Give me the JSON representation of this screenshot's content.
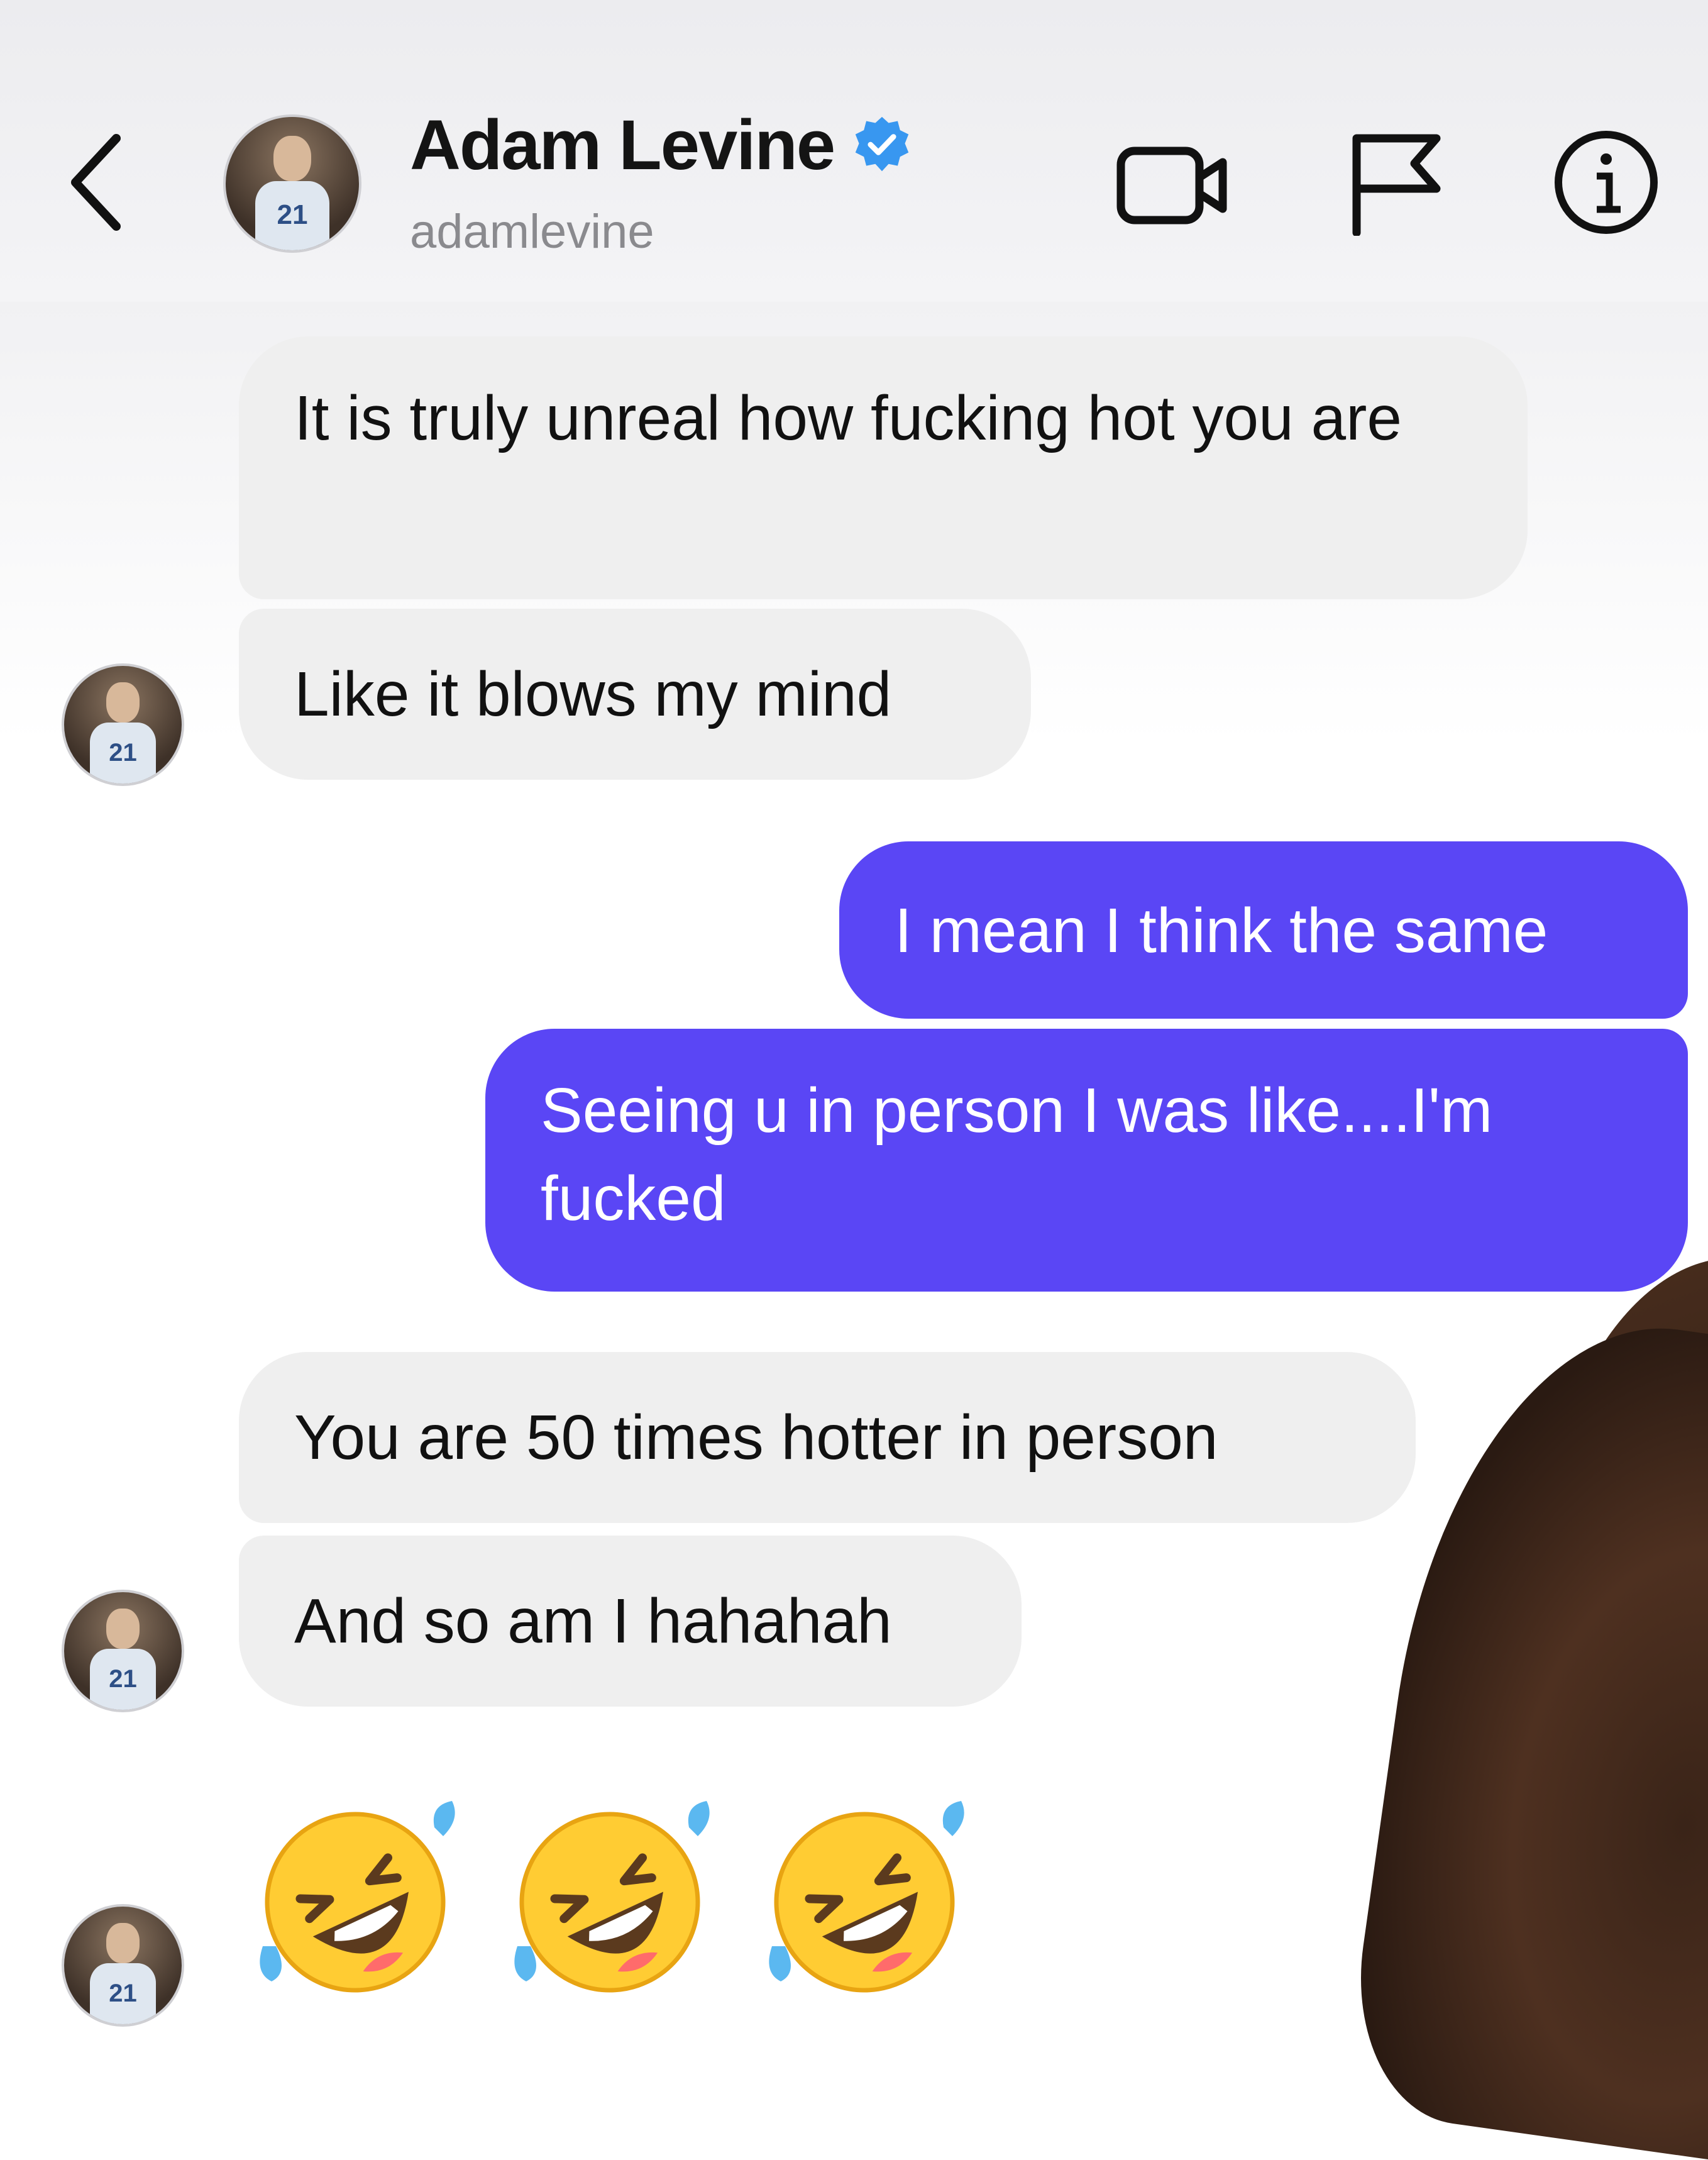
{
  "header": {
    "name": "Adam Levine",
    "username": "adamlevine",
    "avatar_number": "21"
  },
  "messages": [
    {
      "direction": "incoming",
      "text": "It is truly unreal how fucking hot you are"
    },
    {
      "direction": "incoming",
      "text": "Like it blows my mind"
    },
    {
      "direction": "outgoing",
      "text": "I mean I think the same"
    },
    {
      "direction": "outgoing",
      "text": "Seeing u in person I was like....I'm fucked"
    },
    {
      "direction": "incoming",
      "text": "You are 50 times hotter in person"
    },
    {
      "direction": "incoming",
      "text": "And so am I hahahah"
    },
    {
      "direction": "incoming",
      "emoji": [
        "rolling-on-floor-laughing",
        "rolling-on-floor-laughing",
        "rolling-on-floor-laughing"
      ]
    }
  ],
  "colors": {
    "outgoing_bubble": "#5a46f5",
    "incoming_bubble": "#efefef",
    "verified": "#3897f0"
  }
}
